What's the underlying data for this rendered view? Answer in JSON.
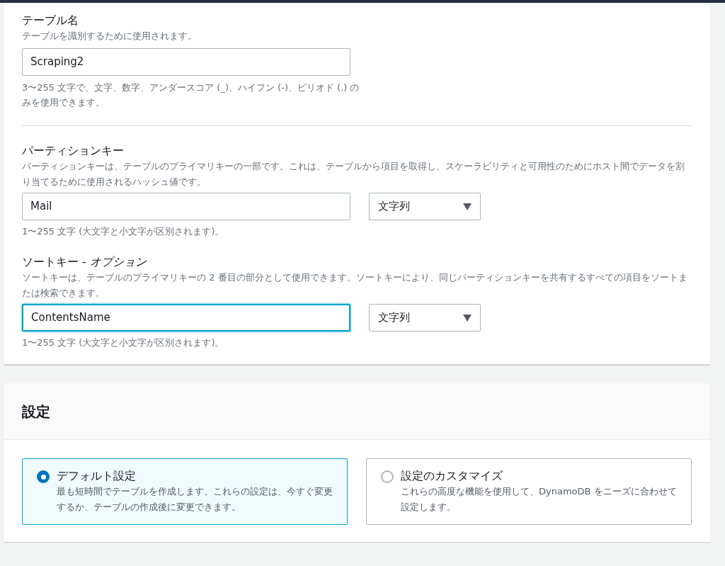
{
  "table_name": {
    "label": "テーブル名",
    "description": "テーブルを識別するために使用されます。",
    "value": "Scraping2",
    "focused": false,
    "hint": "3〜255 文字で、文字、数字、アンダースコア (_)、ハイフン (-)、ピリオド (.) のみを使用できます。"
  },
  "keys": [
    {
      "label": "パーティションキー",
      "description": "パーティションキーは、テーブルのプライマリキーの一部です。これは、テーブルから項目を取得し、スケーラビリティと可用性のためにホスト間でデータを割り当てるために使用されるハッシュ値です。",
      "value": "Mail",
      "focused": false,
      "type": "文字列",
      "hint": "1〜255 文字 (大文字と小文字が区別されます)。"
    },
    {
      "label": "ソートキー - *オプション*",
      "description": "ソートキーは、テーブルのプライマリキーの 2 番目の部分として使用できます。ソートキーにより、同じパーティションキーを共有するすべての項目をソートまたは検索できます。",
      "value": "ContentsName",
      "focused": true,
      "type": "文字列",
      "hint": "1〜255 文字 (大文字と小文字が区別されます)。"
    }
  ],
  "settings": {
    "title": "設定",
    "options": [
      {
        "label": "デフォルト設定",
        "description": "最も短時間でテーブルを作成します。これらの設定は、今すぐ変更するか、テーブルの作成後に変更できます。",
        "selected": true
      },
      {
        "label": "設定のカスタマイズ",
        "description": "これらの高度な機能を使用して、DynamoDB をニーズに合わせて設定します。",
        "selected": false
      }
    ]
  }
}
